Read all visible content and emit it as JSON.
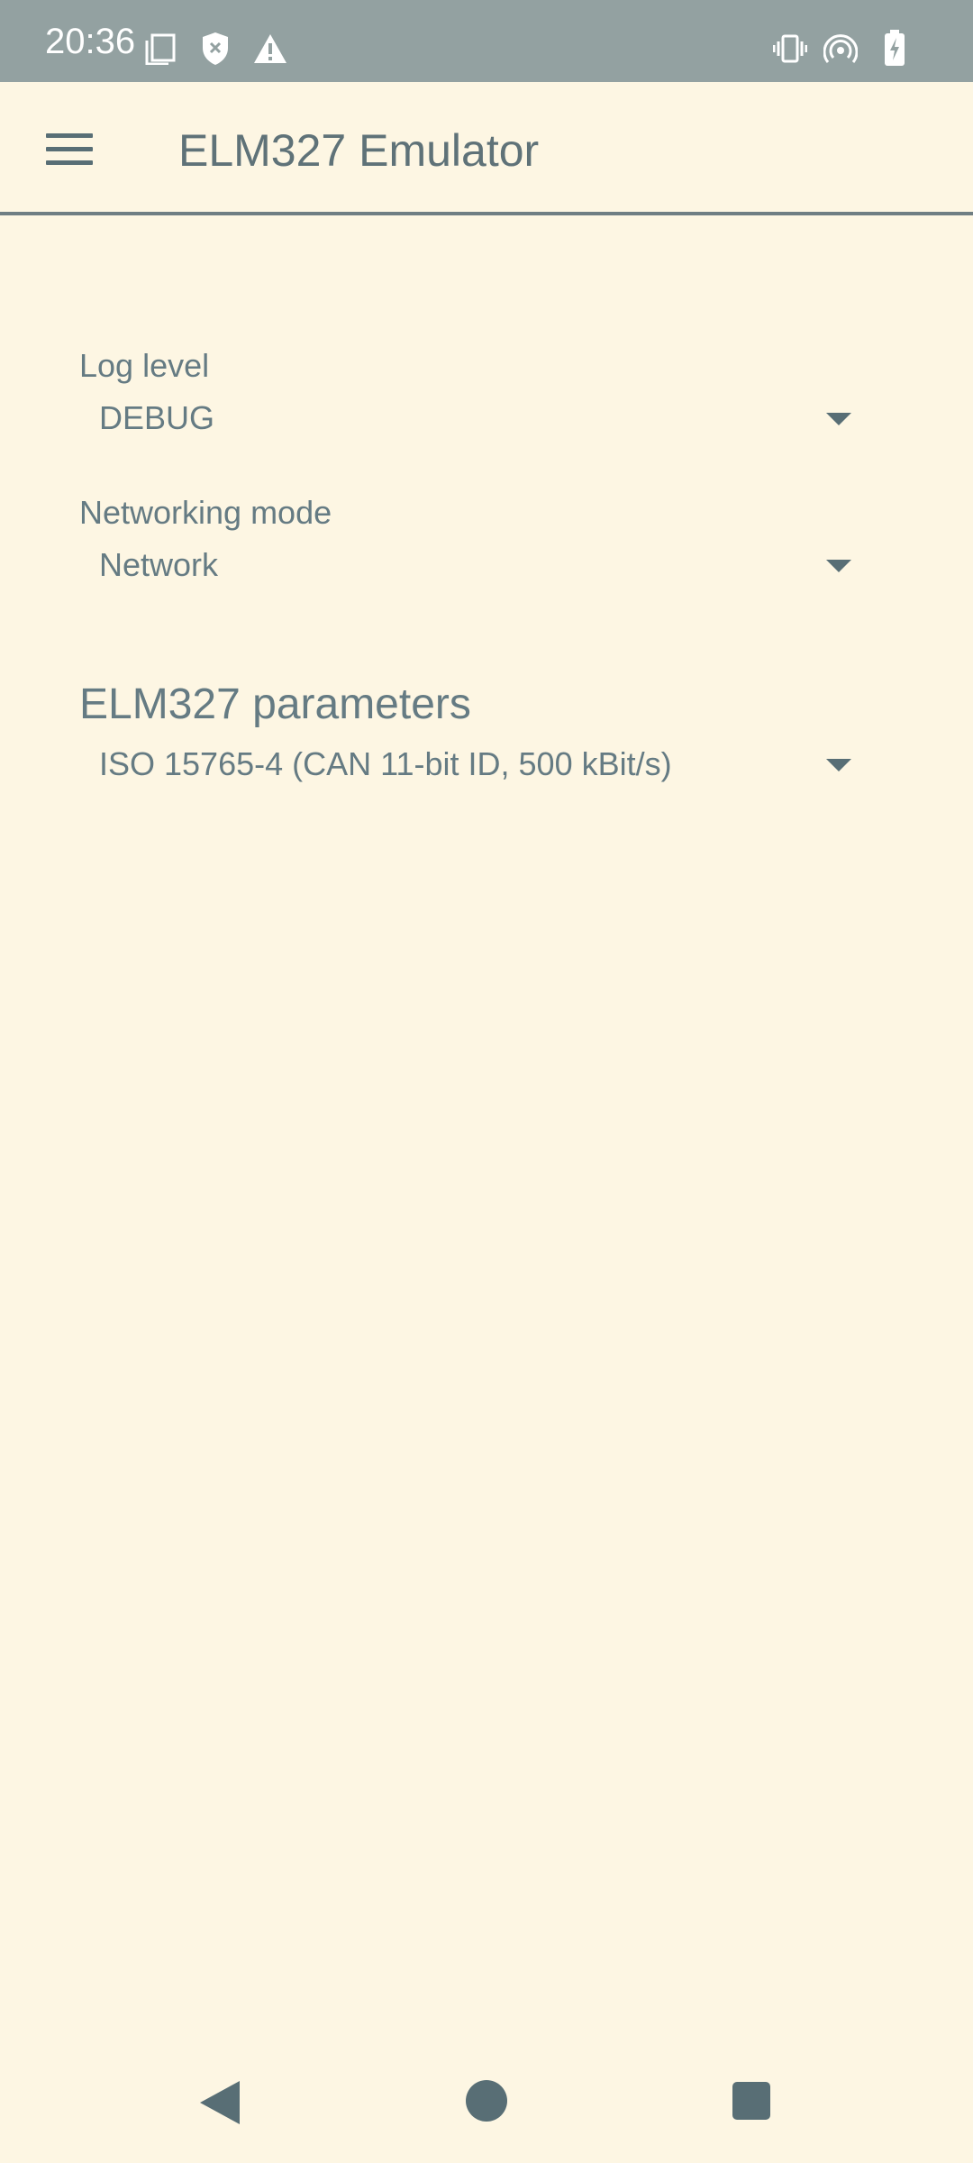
{
  "status_bar": {
    "time": "20:36",
    "left_icons": [
      "screenshot-icon",
      "shield-icon",
      "warning-icon"
    ],
    "right_icons": [
      "vibrate-icon",
      "hotspot-icon",
      "battery-charging-icon"
    ],
    "background_color": "#93a1a1"
  },
  "app_bar": {
    "title": "ELM327 Emulator",
    "menu_icon": "hamburger-menu-icon"
  },
  "settings": {
    "log_level": {
      "label": "Log level",
      "value": "DEBUG"
    },
    "networking_mode": {
      "label": "Networking mode",
      "value": "Network"
    },
    "elm327": {
      "section_title": "ELM327 parameters",
      "protocol_value": "ISO 15765-4 (CAN 11-bit ID, 500 kBit/s)"
    }
  },
  "nav_bar": {
    "buttons": [
      "back-icon",
      "home-icon",
      "recents-icon"
    ]
  },
  "colors": {
    "background": "#fdf6e3",
    "text": "#657b83",
    "accent": "#586e75"
  }
}
